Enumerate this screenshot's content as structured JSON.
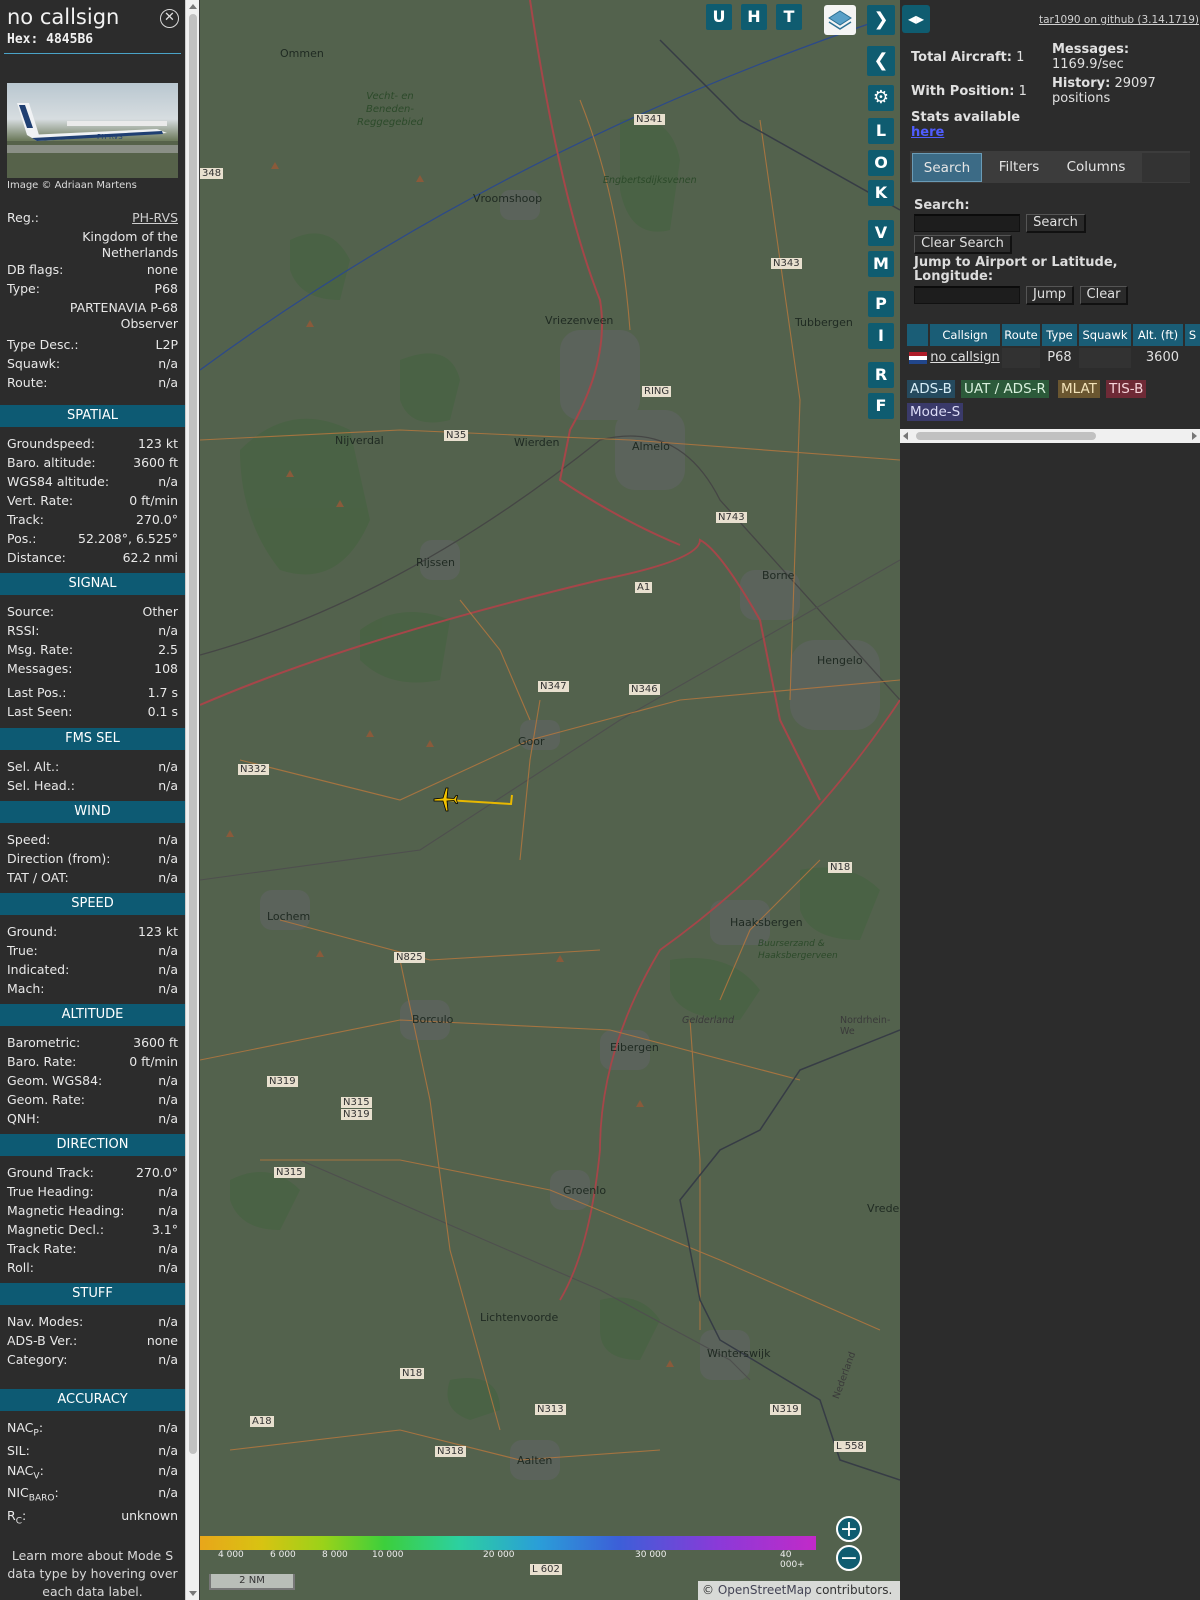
{
  "info": {
    "callsign": "no callsign",
    "hex_label": "Hex:",
    "hex": "4845B6",
    "image_credit": "Image © Adriaan Martens",
    "reg_label": "Reg.:",
    "reg": "PH-RVS",
    "country": "Kingdom of the Netherlands",
    "dbflags_label": "DB flags:",
    "dbflags": "none",
    "type_label": "Type:",
    "type": "P68",
    "type_full": "PARTENAVIA P-68 Observer",
    "typedesc_label": "Type Desc.:",
    "typedesc": "L2P",
    "squawk_label": "Squawk:",
    "squawk": "n/a",
    "route_label": "Route:",
    "route": "n/a",
    "spatial": {
      "title": "SPATIAL",
      "rows": [
        {
          "k": "Groundspeed:",
          "v": "123 kt"
        },
        {
          "k": "Baro. altitude:",
          "v": "3600 ft"
        },
        {
          "k": "WGS84 altitude:",
          "v": "n/a"
        },
        {
          "k": "Vert. Rate:",
          "v": "0 ft/min"
        },
        {
          "k": "Track:",
          "v": "270.0°"
        },
        {
          "k": "Pos.:",
          "v": "52.208°, 6.525°"
        },
        {
          "k": "Distance:",
          "v": "62.2 nmi"
        }
      ]
    },
    "signal": {
      "title": "SIGNAL",
      "rows": [
        {
          "k": "Source:",
          "v": "Other"
        },
        {
          "k": "RSSI:",
          "v": "n/a"
        },
        {
          "k": "Msg. Rate:",
          "v": "2.5"
        },
        {
          "k": "Messages:",
          "v": "108"
        },
        {
          "k": "Last Pos.:",
          "v": "1.7 s"
        },
        {
          "k": "Last Seen:",
          "v": "0.1 s"
        }
      ]
    },
    "fms": {
      "title": "FMS SEL",
      "rows": [
        {
          "k": "Sel. Alt.:",
          "v": "n/a"
        },
        {
          "k": "Sel. Head.:",
          "v": "n/a"
        }
      ]
    },
    "wind": {
      "title": "WIND",
      "rows": [
        {
          "k": "Speed:",
          "v": "n/a"
        },
        {
          "k": "Direction (from):",
          "v": "n/a"
        },
        {
          "k": "TAT / OAT:",
          "v": "n/a"
        }
      ]
    },
    "speed": {
      "title": "SPEED",
      "rows": [
        {
          "k": "Ground:",
          "v": "123 kt"
        },
        {
          "k": "True:",
          "v": "n/a"
        },
        {
          "k": "Indicated:",
          "v": "n/a"
        },
        {
          "k": "Mach:",
          "v": "n/a"
        }
      ]
    },
    "altitude": {
      "title": "ALTITUDE",
      "rows": [
        {
          "k": "Barometric:",
          "v": "3600 ft"
        },
        {
          "k": "Baro. Rate:",
          "v": "0 ft/min"
        },
        {
          "k": "Geom. WGS84:",
          "v": "n/a"
        },
        {
          "k": "Geom. Rate:",
          "v": "n/a"
        },
        {
          "k": "QNH:",
          "v": "n/a"
        }
      ]
    },
    "direction": {
      "title": "DIRECTION",
      "rows": [
        {
          "k": "Ground Track:",
          "v": "270.0°"
        },
        {
          "k": "True Heading:",
          "v": "n/a"
        },
        {
          "k": "Magnetic Heading:",
          "v": "n/a"
        },
        {
          "k": "Magnetic Decl.:",
          "v": "3.1°"
        },
        {
          "k": "Track Rate:",
          "v": "n/a"
        },
        {
          "k": "Roll:",
          "v": "n/a"
        }
      ]
    },
    "stuff": {
      "title": "STUFF",
      "rows": [
        {
          "k": "Nav. Modes:",
          "v": "n/a"
        },
        {
          "k": "ADS-B Ver.:",
          "v": "none"
        },
        {
          "k": "Category:",
          "v": "n/a"
        }
      ]
    },
    "accuracy": {
      "title": "ACCURACY",
      "rows": [
        {
          "k": "NAC",
          "sub": "P",
          "v": "n/a"
        },
        {
          "k": "SIL:",
          "sub": "",
          "v": "n/a"
        },
        {
          "k": "NAC",
          "sub": "V",
          "v": "n/a"
        },
        {
          "k": "NIC",
          "sub": "BARO",
          "v": "n/a"
        },
        {
          "k": "R",
          "sub": "C",
          "v": "unknown"
        }
      ]
    },
    "learn_more": "Learn more about Mode S data type by hovering over each data label."
  },
  "map": {
    "buttons_top": [
      "U",
      "H",
      "T"
    ],
    "buttons_side": [
      "L",
      "O",
      "K",
      "V",
      "M",
      "P",
      "I",
      "R",
      "F"
    ],
    "altitude_legend": [
      "4 000",
      "6 000",
      "8 000",
      "10 000",
      "20 000",
      "30 000",
      "40 000+"
    ],
    "scale": "2 NM",
    "attribution_prefix": "© ",
    "attribution_link": "OpenStreetMap",
    "attribution_suffix": " contributors.",
    "places": [
      "Ommen",
      "Vecht- en Beneden- Reggegebied",
      "Vroomshoop",
      "Engbertsdijksvenen",
      "Vriezenveen",
      "Tubbergen",
      "Nijverdal",
      "Wierden",
      "Almelo",
      "Rijssen",
      "Borne",
      "Hengelo",
      "Goor",
      "Lochem",
      "Haaksbergen",
      "Buurserzand & Haaksbergerveen",
      "Borculo",
      "Eibergen",
      "Gelderland",
      "Nordrhein-We",
      "Groenlo",
      "Vrede",
      "Lichtenvoorde",
      "Winterswijk",
      "Aalten",
      "Nederland"
    ],
    "roads": [
      "N341",
      "N343",
      "N35",
      "RING",
      "N743",
      "A1",
      "N347",
      "N346",
      "N332",
      "N18",
      "N825",
      "N319",
      "N315",
      "N319",
      "N315",
      "N313",
      "N318",
      "L 558",
      "L 602",
      "A18",
      "N18",
      "N319",
      "348"
    ],
    "colors": {
      "accent": "#0f5c70",
      "plane": "#f2c300",
      "track": "#e8b800",
      "map_bg": "#5b6a54"
    }
  },
  "sidebar": {
    "github": "tar1090 on github (3.14.1719)",
    "total_aircraft_label": "Total Aircraft:",
    "total_aircraft": "1",
    "with_position_label": "With Position:",
    "with_position": "1",
    "messages_label": "Messages:",
    "messages": "1169.9/sec",
    "history_label": "History:",
    "history": "29097 positions",
    "stats_label": "Stats available",
    "stats_link": "here",
    "tabs": [
      "Search",
      "Filters",
      "Columns"
    ],
    "search_label": "Search:",
    "search_button": "Search",
    "clear_search_button": "Clear Search",
    "jump_label": "Jump to Airport or Latitude, Longitude:",
    "jump_button": "Jump",
    "clear_button": "Clear",
    "table_headers": [
      "Callsign",
      "Route",
      "Type",
      "Squawk",
      "Alt. (ft)",
      "S"
    ],
    "table_rows": [
      {
        "callsign": "no callsign",
        "route": "",
        "type": "P68",
        "squawk": "",
        "alt": "3600"
      }
    ],
    "source_badges": [
      "ADS-B",
      "UAT / ADS-R",
      "MLAT",
      "TIS-B",
      "Mode-S"
    ]
  }
}
